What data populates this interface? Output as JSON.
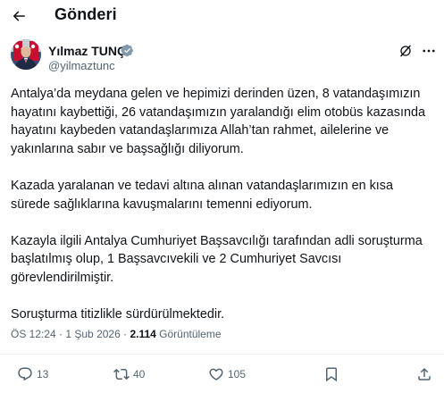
{
  "header": {
    "title": "Gönderi",
    "back_icon": "arrow-left-icon"
  },
  "author": {
    "name": "Yılmaz TUNÇ",
    "handle": "@yilmaztunc",
    "verified_color": "#829aab"
  },
  "tweet": {
    "paragraphs": [
      "Antalya’da meydana gelen ve hepimizi derinden üzen, 8 vatandaşımızın hayatını kaybettiği, 26 vatandaşımızın yaralandığı elim otobüs kazasında hayatını kaybeden vatandaşlarımıza Allah’tan rahmet, ailelerine ve yakınlarına sabır ve başsağlığı diliyorum.",
      "Kazada yaralanan ve tedavi altına alınan vatandaşlarımızın en kısa sürede sağlıklarına kavuşmalarını temenni ediyorum.",
      "Kazayla ilgili Antalya Cumhuriyet Başsavcılığı tarafından adli soruşturma başlatılmış olup, 1 Başsavcıvekili ve 2 Cumhuriyet Savcısı görevlendirilmiştir.",
      "Soruşturma titizlikle sürdürülmektedir."
    ],
    "time": "ÖS 12:24",
    "date": "1 Şub 2026",
    "views_count": "2.114",
    "views_label": "Görüntüleme"
  },
  "actions": {
    "replies": "13",
    "reposts": "40",
    "likes": "105"
  },
  "colors": {
    "text": "#0f1419",
    "secondary": "#536471",
    "divider": "#eff3f4"
  }
}
